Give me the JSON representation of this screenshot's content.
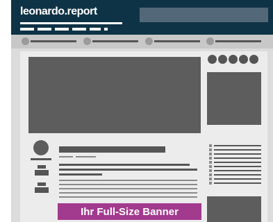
{
  "site": {
    "logo": "leonardo.report"
  },
  "banner": {
    "text": "Ihr Full-Size Banner",
    "color": "#a23a8d"
  },
  "colors": {
    "header": "#0f3346",
    "placeholder_dark": "#5d5d5d",
    "page_bg": "#ececec"
  }
}
